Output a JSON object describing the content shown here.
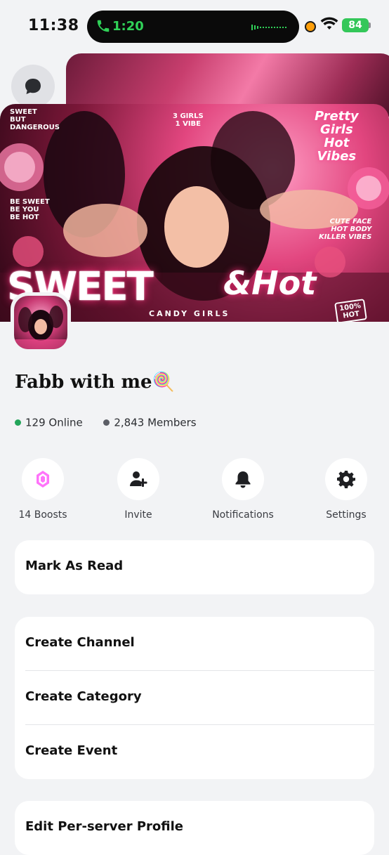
{
  "status_bar": {
    "time": "11:38",
    "call_time": "1:20",
    "battery": "84"
  },
  "banner": {
    "top_left": "SWEET\nBUT\nDANGEROUS",
    "top_center": "3 GIRLS\n1 VIBE",
    "top_right": "Pretty\nGirls\nHot\nVibes",
    "left_text": "BE SWEET\nBE YOU\nBE HOT",
    "right_text": "CUTE FACE\nHOT BODY\nKILLER VIBES",
    "title_main": "SWEET",
    "title_script": "&Hot",
    "subtitle": "CANDY GIRLS",
    "badge": "100%\nHOT"
  },
  "server": {
    "name": "Fabb with me🍭",
    "online": "129 Online",
    "members": "2,843 Members"
  },
  "actions": [
    {
      "label": "14 Boosts",
      "icon": "boost-gem-icon"
    },
    {
      "label": "Invite",
      "icon": "add-user-icon"
    },
    {
      "label": "Notifications",
      "icon": "bell-icon"
    },
    {
      "label": "Settings",
      "icon": "gear-icon"
    }
  ],
  "menu": {
    "mark_as_read": "Mark As Read",
    "create_channel": "Create Channel",
    "create_category": "Create Category",
    "create_event": "Create Event",
    "edit_profile": "Edit Per-server Profile"
  },
  "colors": {
    "background": "#f2f3f5",
    "online": "#23a55a",
    "call_green": "#30d158",
    "boost_pink": "#ff73fa"
  }
}
